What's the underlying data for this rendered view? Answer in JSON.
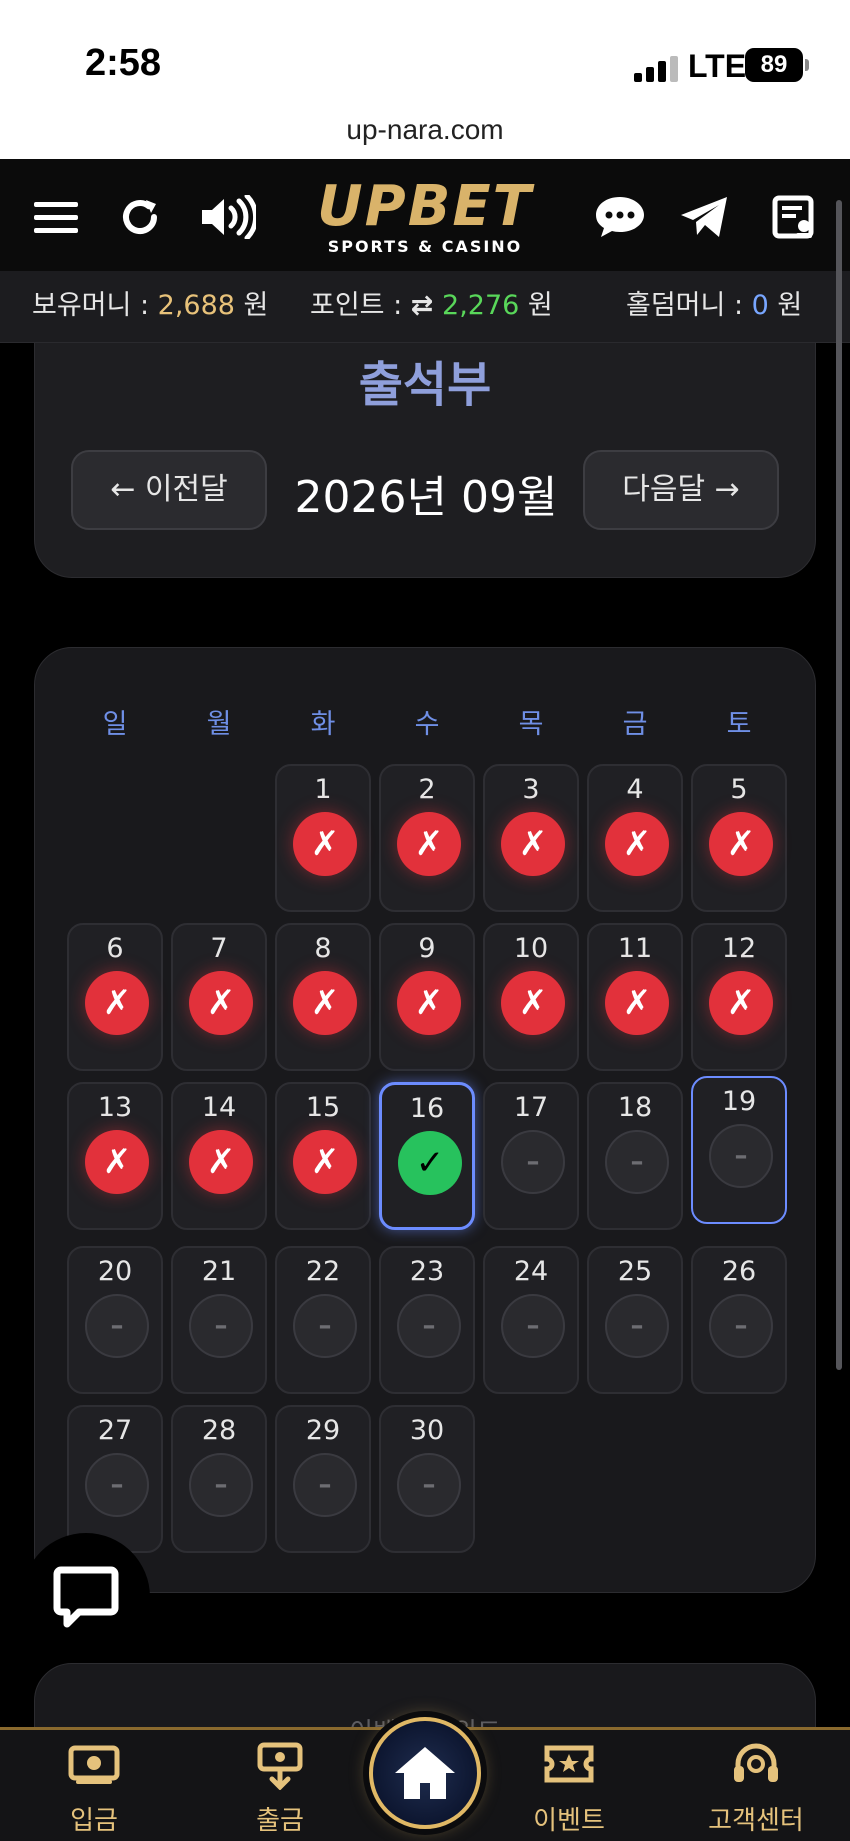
{
  "status_bar": {
    "time": "2:58",
    "network": "LTE",
    "battery": "89"
  },
  "browser": {
    "url": "up-nara.com"
  },
  "header": {
    "logo_text": "UPBET",
    "logo_sub": "SPORTS & CASINO",
    "icons": [
      "menu-icon",
      "refresh-icon",
      "sound-icon",
      "chat-icon",
      "telegram-icon",
      "notice-icon"
    ]
  },
  "balance": {
    "money_label": "보유머니 :",
    "money_value": "2,688",
    "money_unit": "원",
    "point_label": "포인트 :",
    "point_value": "2,276",
    "point_unit": "원",
    "holdem_label": "홀덤머니 :",
    "holdem_value": "0",
    "holdem_unit": "원"
  },
  "attendance": {
    "title": "출석부",
    "prev_label": "← 이전달",
    "next_label": "다음달 →",
    "month_label": "2026년 09월"
  },
  "calendar": {
    "weekdays": [
      "일",
      "월",
      "화",
      "수",
      "목",
      "금",
      "토"
    ],
    "first_weekday": 2,
    "today": 16,
    "highlight": 19,
    "days": [
      {
        "day": "1",
        "status": "miss"
      },
      {
        "day": "2",
        "status": "miss"
      },
      {
        "day": "3",
        "status": "miss"
      },
      {
        "day": "4",
        "status": "miss"
      },
      {
        "day": "5",
        "status": "miss"
      },
      {
        "day": "6",
        "status": "miss"
      },
      {
        "day": "7",
        "status": "miss"
      },
      {
        "day": "8",
        "status": "miss"
      },
      {
        "day": "9",
        "status": "miss"
      },
      {
        "day": "10",
        "status": "miss"
      },
      {
        "day": "11",
        "status": "miss"
      },
      {
        "day": "12",
        "status": "miss"
      },
      {
        "day": "13",
        "status": "miss"
      },
      {
        "day": "14",
        "status": "miss"
      },
      {
        "day": "15",
        "status": "miss"
      },
      {
        "day": "16",
        "status": "checked"
      },
      {
        "day": "17",
        "status": "none"
      },
      {
        "day": "18",
        "status": "none"
      },
      {
        "day": "19",
        "status": "none"
      },
      {
        "day": "20",
        "status": "none"
      },
      {
        "day": "21",
        "status": "none"
      },
      {
        "day": "22",
        "status": "none"
      },
      {
        "day": "23",
        "status": "none"
      },
      {
        "day": "24",
        "status": "none"
      },
      {
        "day": "25",
        "status": "none"
      },
      {
        "day": "26",
        "status": "none"
      },
      {
        "day": "27",
        "status": "none"
      },
      {
        "day": "28",
        "status": "none"
      },
      {
        "day": "29",
        "status": "none"
      },
      {
        "day": "30",
        "status": "none"
      }
    ],
    "symbols": {
      "miss": "✗",
      "checked": "✓",
      "none": "–"
    }
  },
  "partial_card_text": "이벤트 리워드",
  "bottom_nav": {
    "deposit": "입금",
    "withdraw": "출금",
    "event": "이벤트",
    "support": "고객센터"
  },
  "colors": {
    "accent_gold": "#e8c27a",
    "miss_red": "#e2313b",
    "check_green": "#27c25d",
    "today_blue": "#6c8cff"
  }
}
